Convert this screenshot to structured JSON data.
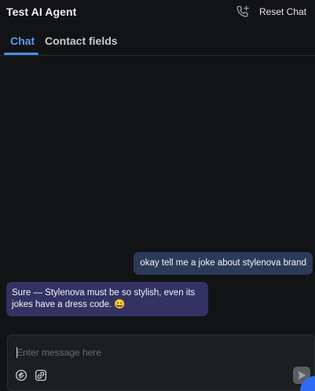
{
  "header": {
    "title": "Test AI Agent",
    "reset_label": "Reset Chat",
    "call_icon": "phone-plus-icon"
  },
  "tabs": [
    {
      "label": "Chat",
      "active": true
    },
    {
      "label": "Contact fields",
      "active": false
    }
  ],
  "messages": [
    {
      "role": "user",
      "text": "okay tell me a joke about stylenova brand"
    },
    {
      "role": "assistant",
      "text": "Sure — Stylenova must be so stylish, even its jokes have a dress code. 😄"
    }
  ],
  "composer": {
    "placeholder": "Enter message here",
    "value": "",
    "tools": [
      "attachment-icon",
      "link-icon"
    ],
    "send_icon": "send-icon"
  },
  "colors": {
    "background": "#121315",
    "accent": "#5a9bff",
    "user_bubble": "#2c3a5a",
    "assistant_bubble": "#333263",
    "fab": "#2f6bf2"
  }
}
